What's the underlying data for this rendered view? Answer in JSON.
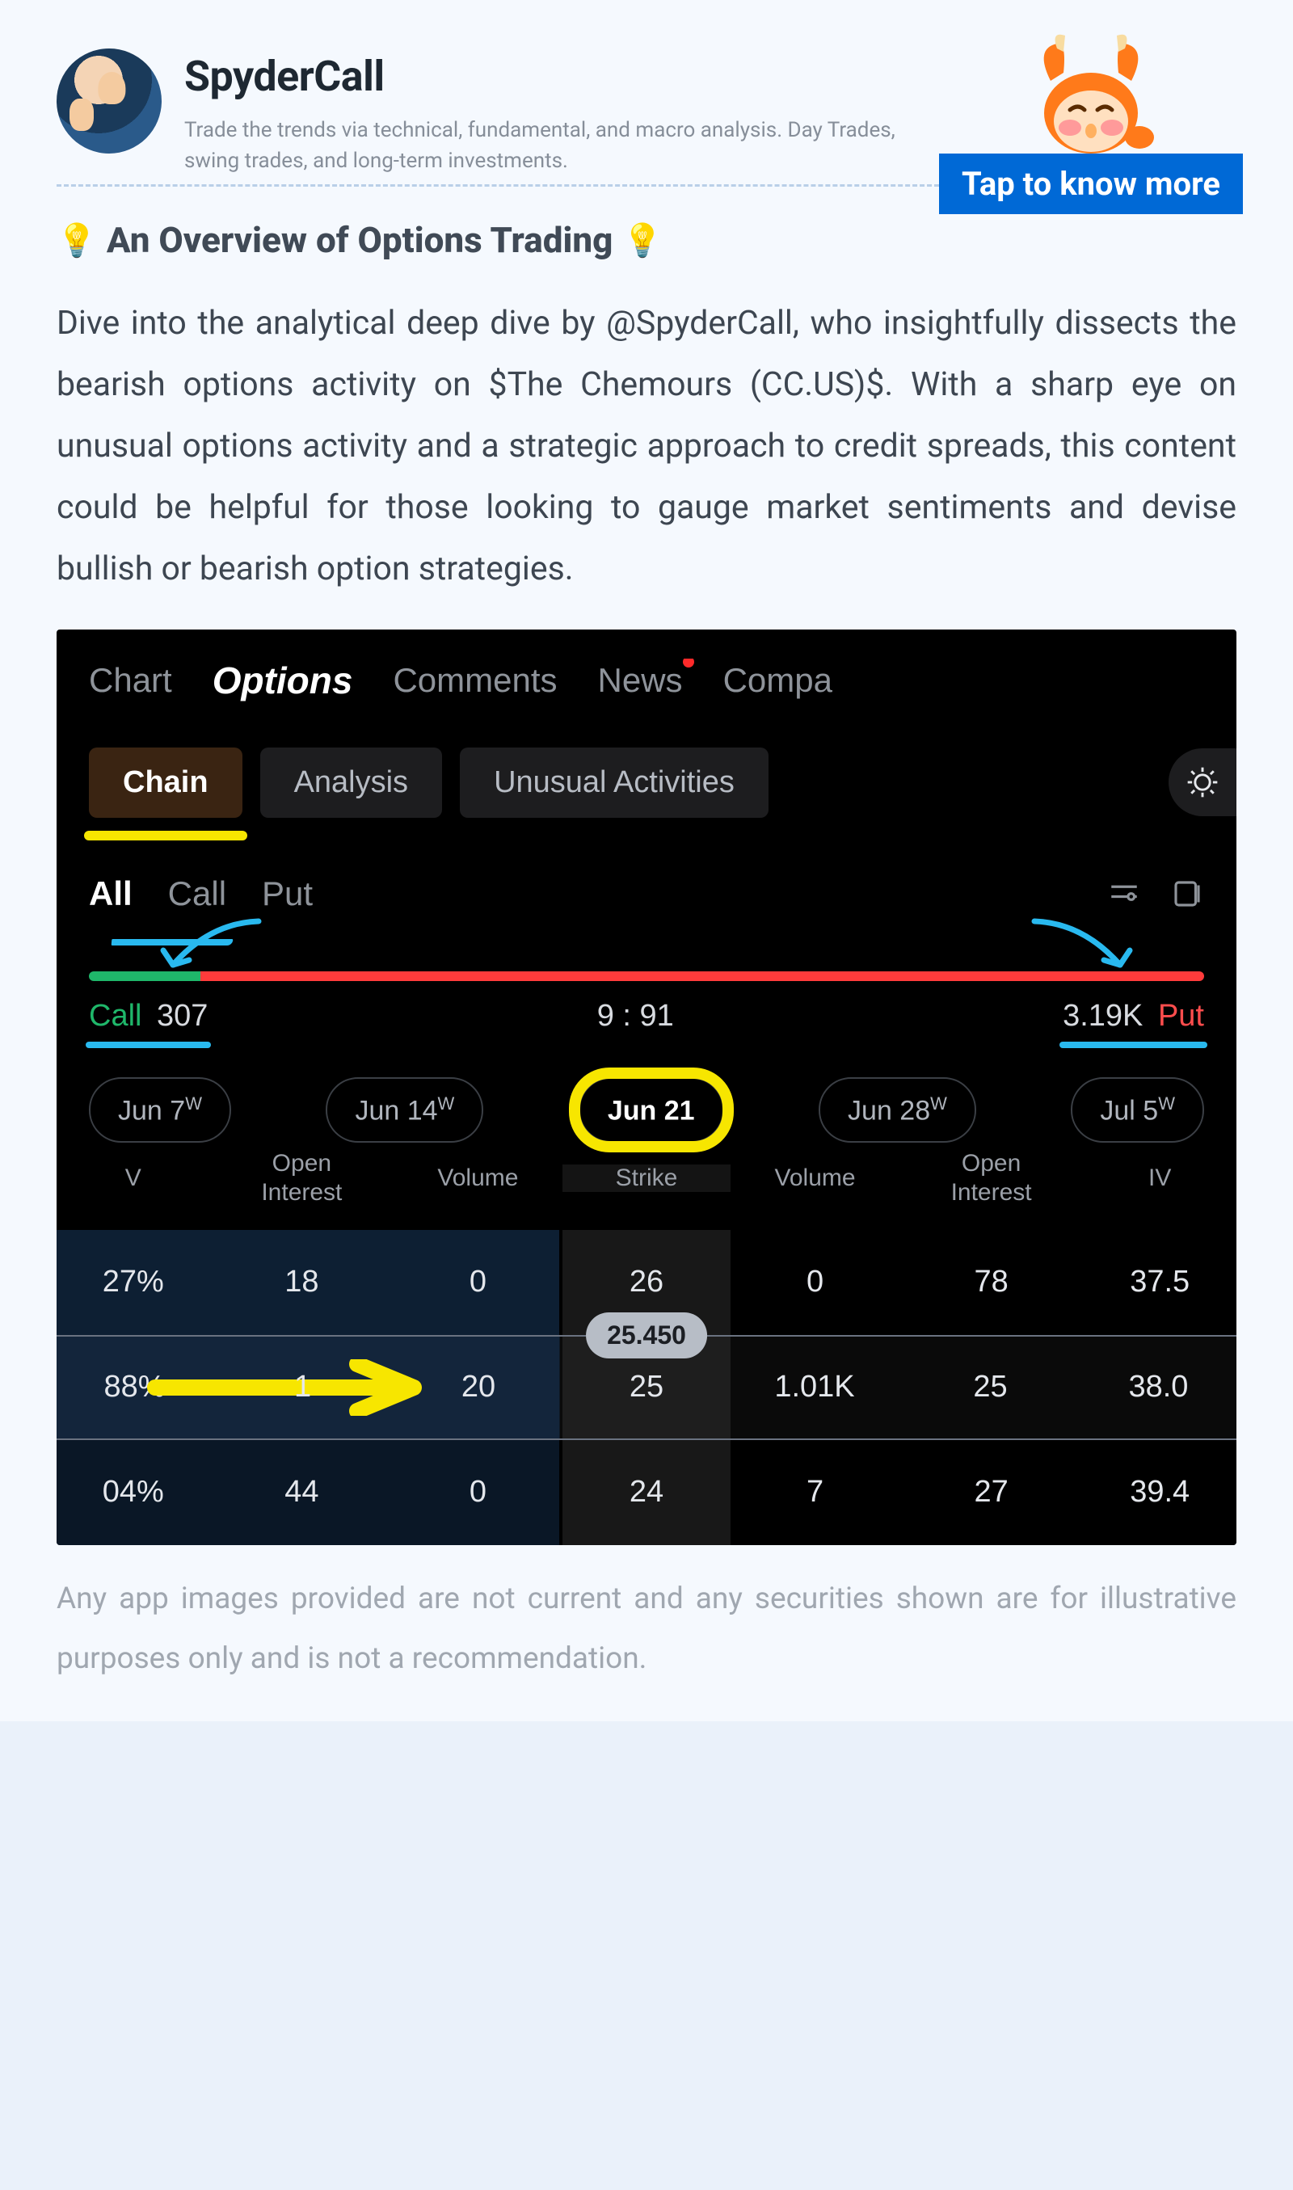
{
  "author": {
    "name": "SpyderCall",
    "bio": "Trade the trends via technical, fundamental, and macro analysis. Day Trades, swing trades, and long-term investments."
  },
  "cta": "Tap to know more",
  "section": {
    "bulb": "💡",
    "title": "An Overview of Options Trading"
  },
  "body": "Dive into the analytical deep dive by @SpyderCall, who insightfully dissects the bearish options activity on $The Chemours (CC.US)$. With a sharp eye on unusual options activity and a strategic approach to credit spreads, this content could be helpful for those looking to gauge market sentiments and devise bullish or bearish option strategies.",
  "shot": {
    "topTabs": [
      "Chart",
      "Options",
      "Comments",
      "News",
      "Compa"
    ],
    "subTabs": [
      "Chain",
      "Analysis",
      "Unusual Activities"
    ],
    "filters": {
      "all": "All",
      "call": "Call",
      "put": "Put"
    },
    "ratio": {
      "callLabel": "Call",
      "callCount": "307",
      "mid": "9 : 91",
      "putCount": "3.19K",
      "putLabel": "Put"
    },
    "expiries": [
      "Jun 7",
      "Jun 14",
      "Jun 21",
      "Jun 28",
      "Jul 5"
    ],
    "expiriesSup": [
      "W",
      "W",
      "",
      "W",
      "W"
    ],
    "columns": [
      "V",
      "Open Interest",
      "Volume",
      "Strike",
      "Volume",
      "Open Interest",
      "IV"
    ],
    "priceTag": "25.450",
    "rows": [
      {
        "iv_l": "27%",
        "oi_l": "18",
        "vol_l": "0",
        "strike": "26",
        "vol_r": "0",
        "oi_r": "78",
        "iv_r": "37.5"
      },
      {
        "iv_l": "88%",
        "oi_l": "1",
        "vol_l": "20",
        "strike": "25",
        "vol_r": "1.01K",
        "oi_r": "25",
        "iv_r": "38.0"
      },
      {
        "iv_l": "04%",
        "oi_l": "44",
        "vol_l": "0",
        "strike": "24",
        "vol_r": "7",
        "oi_r": "27",
        "iv_r": "39.4"
      }
    ]
  },
  "disclaimer": "Any app images provided are not current and any securities shown are for illustrative purposes only and is not a recommendation."
}
